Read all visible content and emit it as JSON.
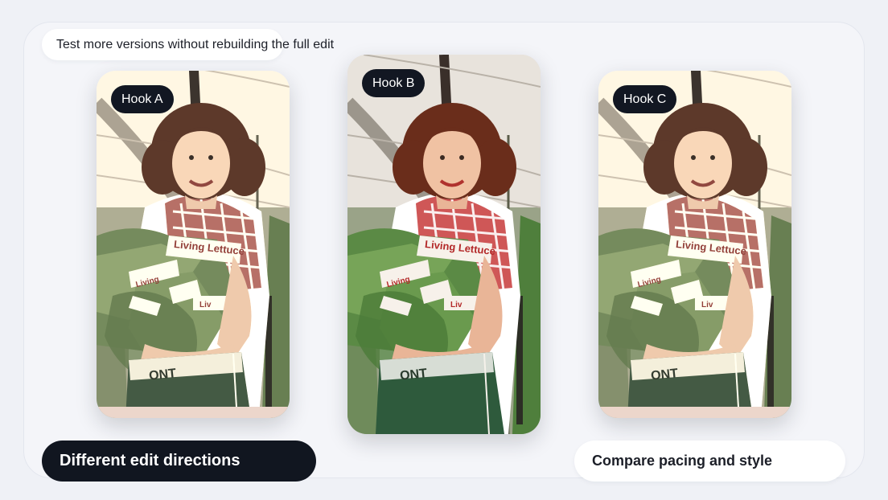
{
  "header": {
    "caption": "Test more versions without rebuilding the full edit"
  },
  "variants": [
    {
      "label": "Hook A"
    },
    {
      "label": "Hook B"
    },
    {
      "label": "Hook C"
    }
  ],
  "footer": {
    "left_label": "Different edit directions",
    "right_label": "Compare pacing and style"
  },
  "photo": {
    "bag_label": "Living Lettuce",
    "apron_text": "ONT"
  }
}
